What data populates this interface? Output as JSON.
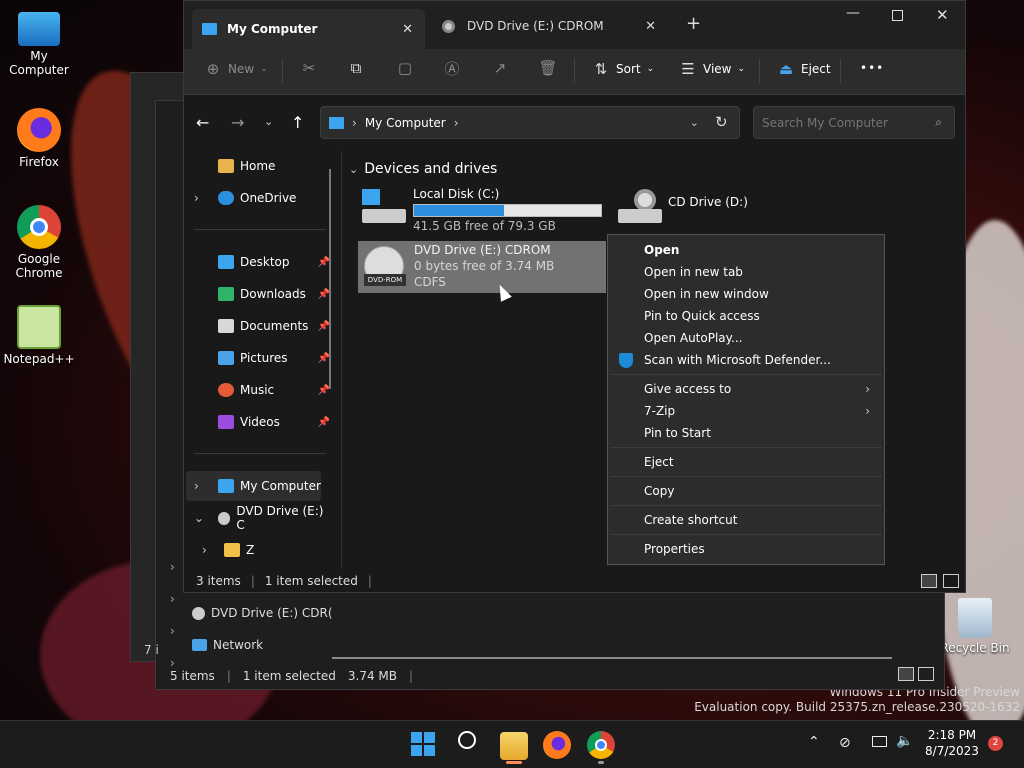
{
  "desktop": {
    "icons": [
      {
        "label": "My Computer"
      },
      {
        "label": "Firefox"
      },
      {
        "label": "Google Chrome"
      },
      {
        "label": "Notepad++"
      },
      {
        "label": "Recycle Bin"
      }
    ],
    "watermark": {
      "line1": "Windows 11 Pro Insider Preview",
      "line2": "Evaluation copy. Build 25375.zn_release.230520-1632"
    }
  },
  "back_window": {
    "nav_items": [
      "DVD Drive (E:) CDR(",
      "Network"
    ],
    "status": {
      "items": "5 items",
      "selected": "1 item selected",
      "size": "3.74 MB"
    },
    "partial_label": "7 i"
  },
  "window": {
    "tabs": [
      {
        "label": "My Computer",
        "active": true
      },
      {
        "label": "DVD Drive (E:) CDROM",
        "active": false
      }
    ],
    "new_tab": "+",
    "toolbar": {
      "new": "New",
      "sort": "Sort",
      "view": "View",
      "eject": "Eject",
      "more": "•••"
    },
    "breadcrumb": {
      "location": "My Computer"
    },
    "search": {
      "placeholder": "Search My Computer"
    },
    "nav": {
      "home": "Home",
      "onedrive": "OneDrive",
      "quick": [
        "Desktop",
        "Downloads",
        "Documents",
        "Pictures",
        "Music",
        "Videos"
      ],
      "my_computer": "My Computer",
      "dvd": "DVD Drive (E:) C",
      "folder_z": "Z"
    },
    "section": "Devices and drives",
    "drives": [
      {
        "name": "Local Disk (C:)",
        "free": "41.5 GB free of 79.3 GB",
        "used_fraction": 0.48
      },
      {
        "name": "CD Drive (D:)"
      },
      {
        "name": "DVD Drive (E:) CDROM",
        "free": "0 bytes free of 3.74 MB",
        "fs": "CDFS",
        "badge": "DVD-ROM"
      }
    ],
    "status": {
      "items": "3 items",
      "selected": "1 item selected"
    }
  },
  "context_menu": {
    "group1": [
      "Open",
      "Open in new tab",
      "Open in new window",
      "Pin to Quick access",
      "Open AutoPlay...",
      "Scan with Microsoft Defender..."
    ],
    "group2": [
      "Give access to",
      "7-Zip",
      "Pin to Start"
    ],
    "eject": "Eject",
    "copy": "Copy",
    "shortcut": "Create shortcut",
    "properties": "Properties"
  },
  "taskbar": {
    "time": "2:18 PM",
    "date": "8/7/2023",
    "badge": "2"
  },
  "colors": {
    "accent": "#0078d4",
    "defender": "#1e8ad6",
    "badge": "#e0463e"
  }
}
